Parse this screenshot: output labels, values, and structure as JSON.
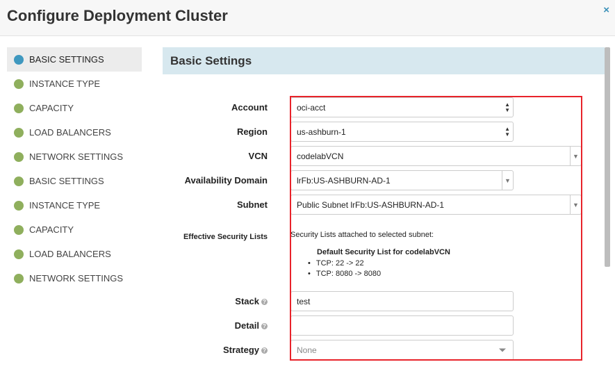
{
  "dialog": {
    "title": "Configure Deployment Cluster",
    "close_icon": "×"
  },
  "sidebar": {
    "items": [
      {
        "label": "BASIC SETTINGS",
        "active": true
      },
      {
        "label": "INSTANCE TYPE"
      },
      {
        "label": "CAPACITY"
      },
      {
        "label": "LOAD BALANCERS"
      },
      {
        "label": "NETWORK SETTINGS"
      },
      {
        "label": "BASIC SETTINGS"
      },
      {
        "label": "INSTANCE TYPE"
      },
      {
        "label": "CAPACITY"
      },
      {
        "label": "LOAD BALANCERS"
      },
      {
        "label": "NETWORK SETTINGS"
      }
    ]
  },
  "section": {
    "title": "Basic Settings"
  },
  "form": {
    "account": {
      "label": "Account",
      "value": "oci-acct"
    },
    "region": {
      "label": "Region",
      "value": "us-ashburn-1"
    },
    "vcn": {
      "label": "VCN",
      "value": "codelabVCN"
    },
    "availability_domain": {
      "label": "Availability Domain",
      "value": "lrFb:US-ASHBURN-AD-1"
    },
    "subnet": {
      "label": "Subnet",
      "value": "Public Subnet lrFb:US-ASHBURN-AD-1"
    },
    "security": {
      "label": "Effective Security Lists",
      "intro": "Security Lists attached to selected subnet:",
      "list_title": "Default Security List for codelabVCN",
      "rules": [
        "TCP: 22 -> 22",
        "TCP: 8080 -> 8080"
      ]
    },
    "stack": {
      "label": "Stack",
      "value": "test"
    },
    "detail": {
      "label": "Detail",
      "value": ""
    },
    "strategy": {
      "label": "Strategy",
      "value": "None"
    }
  },
  "colors": {
    "accent": "#3f98bf",
    "step_dot": "#8faf5d",
    "highlight": "#e8232a",
    "section_bg": "#d7e8ef"
  }
}
